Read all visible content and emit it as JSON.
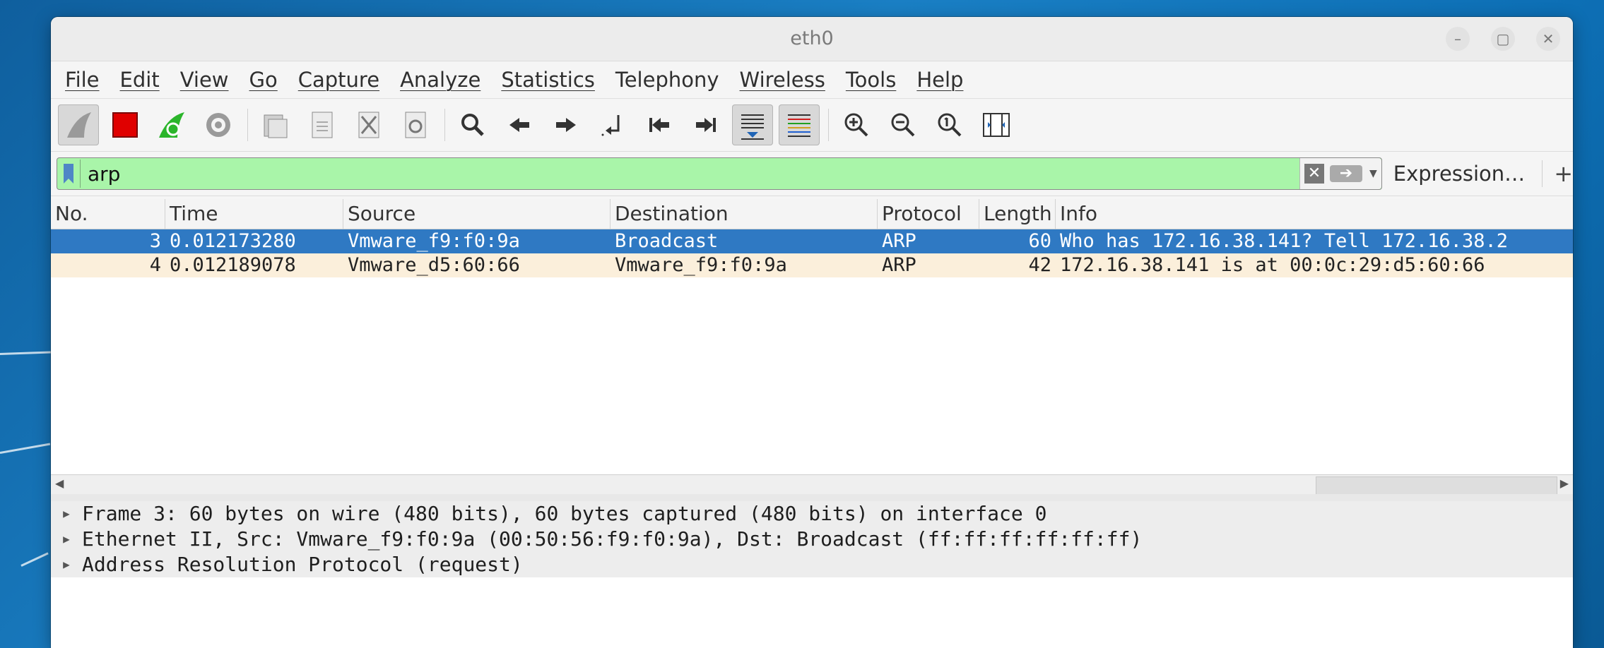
{
  "window": {
    "title": "eth0"
  },
  "menu": [
    "File",
    "Edit",
    "View",
    "Go",
    "Capture",
    "Analyze",
    "Statistics",
    "Telephony",
    "Wireless",
    "Tools",
    "Help"
  ],
  "toolbar": {
    "icons": [
      "start-capture-icon",
      "stop-capture-icon",
      "restart-capture-icon",
      "capture-options-icon",
      "open-file-icon",
      "save-file-icon",
      "close-file-icon",
      "reload-file-icon",
      "find-packet-icon",
      "go-back-icon",
      "go-forward-icon",
      "go-to-packet-icon",
      "first-packet-icon",
      "last-packet-icon",
      "auto-scroll-icon",
      "colorize-icon",
      "zoom-in-icon",
      "zoom-out-icon",
      "normal-size-icon",
      "resize-columns-icon"
    ]
  },
  "filter": {
    "value": "arp",
    "expression_label": "Expression…",
    "plus_label": "+"
  },
  "columns": [
    "No.",
    "Time",
    "Source",
    "Destination",
    "Protocol",
    "Length",
    "Info"
  ],
  "packets": [
    {
      "no": "3",
      "time": "0.012173280",
      "source": "Vmware_f9:f0:9a",
      "destination": "Broadcast",
      "protocol": "ARP",
      "length": "60",
      "info": "Who has 172.16.38.141? Tell 172.16.38.2"
    },
    {
      "no": "4",
      "time": "0.012189078",
      "source": "Vmware_d5:60:66",
      "destination": "Vmware_f9:f0:9a",
      "protocol": "ARP",
      "length": "42",
      "info": "172.16.38.141 is at 00:0c:29:d5:60:66"
    }
  ],
  "details": [
    "Frame 3: 60 bytes on wire (480 bits), 60 bytes captured (480 bits) on interface 0",
    "Ethernet II, Src: Vmware_f9:f0:9a (00:50:56:f9:f0:9a), Dst: Broadcast (ff:ff:ff:ff:ff:ff)",
    "Address Resolution Protocol (request)"
  ],
  "colors": {
    "filter_bg": "#a9f5a9",
    "selected_row": "#2f79c3",
    "arp_row": "#fbefdb"
  }
}
